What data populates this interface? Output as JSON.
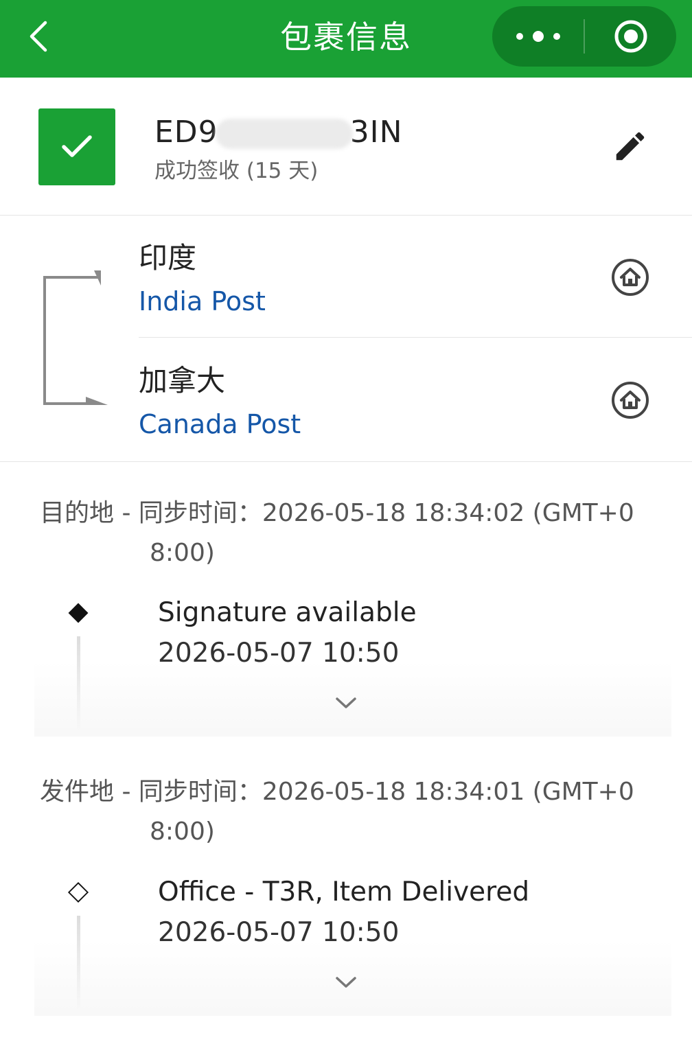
{
  "header": {
    "title": "包裹信息",
    "accent_color": "#1aa135",
    "icons": {
      "back": "chevron-left-icon",
      "more": "more-dots-icon",
      "close": "record-circle-icon"
    }
  },
  "package": {
    "tracking_prefix": "ED9",
    "tracking_suffix": "3IN",
    "status_text": "成功签收 (15 天)",
    "status_icon": "check-icon",
    "edit_icon": "pencil-icon"
  },
  "route": {
    "origin": {
      "country": "印度",
      "carrier": "India Post",
      "icon": "home-circle-icon"
    },
    "destination": {
      "country": "加拿大",
      "carrier": "Canada Post",
      "icon": "home-circle-icon"
    }
  },
  "sections": [
    {
      "label": "目的地 - 同步时间：",
      "sync_time_a": "2026-05-18 18:34:02 (GMT+0",
      "sync_time_b": "8:00)",
      "event": {
        "marker": "filled-diamond-icon",
        "description": "Signature available",
        "time": "2026-05-07 10:50"
      }
    },
    {
      "label": "发件地 - 同步时间：",
      "sync_time_a": "2026-05-18 18:34:01 (GMT+0",
      "sync_time_b": "8:00)",
      "event": {
        "marker": "outline-diamond-icon",
        "description": "Office - T3R, Item Delivered",
        "time": "2026-05-07 10:50"
      }
    }
  ]
}
